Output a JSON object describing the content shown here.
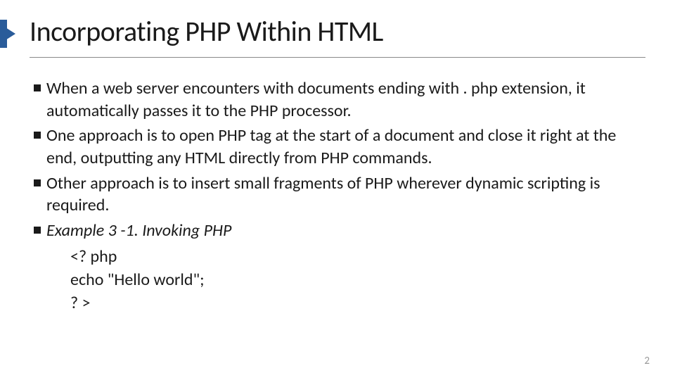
{
  "slide": {
    "title": "Incorporating PHP Within HTML",
    "bullets": [
      {
        "text": "When a web server encounters with documents ending with . php extension, it automatically passes it to the PHP processor.",
        "italic": false
      },
      {
        "text": "One approach is to open PHP tag at the start of a document and close it right at the end, outputting any HTML directly from PHP commands.",
        "italic": false
      },
      {
        "text": "Other approach is to insert small fragments of PHP wherever dynamic scripting is required.",
        "italic": false
      },
      {
        "text": "Example 3 -1. Invoking PHP",
        "italic": true
      }
    ],
    "code": {
      "line1": "<? php",
      "line2": "echo \"Hello world\";",
      "line3": "? >"
    },
    "page_number": "2"
  }
}
